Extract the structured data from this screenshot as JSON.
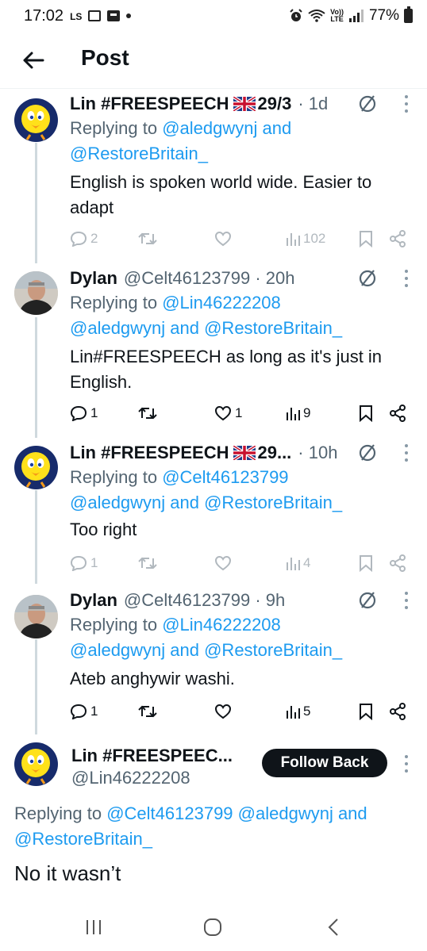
{
  "status_bar": {
    "time": "17:02",
    "ls": "LS",
    "volte_top": "Vo))",
    "volte_bottom": "LTE",
    "battery": "77%"
  },
  "header": {
    "title": "Post"
  },
  "tweets": [
    {
      "name": "Lin #FREESPEECH",
      "flag_suffix": "29/3",
      "handle": "",
      "time": "· 1d",
      "reply_label": "Replying to",
      "mentions": [
        "@aledgwynj and",
        "@RestoreBritain_"
      ],
      "text": "English is spoken world wide. Easier to adapt",
      "replies": "2",
      "retweets": "",
      "likes": "",
      "views": "102",
      "faded": true
    },
    {
      "name": "Dylan",
      "flag_suffix": "",
      "handle": "@Celt46123799 · 20h",
      "reply_label": "Replying to",
      "mentions": [
        "@Lin46222208",
        "@aledgwynj and @RestoreBritain_"
      ],
      "text": "Lin#FREESPEECH as long as it's just in English.",
      "replies": "1",
      "retweets": "",
      "likes": "1",
      "views": "9",
      "faded": false
    },
    {
      "name": "Lin #FREESPEECH",
      "flag_suffix": "29...",
      "handle": "",
      "time": "· 10h",
      "reply_label": "Replying to",
      "mentions": [
        "@Celt46123799",
        "@aledgwynj and @RestoreBritain_"
      ],
      "text": "Too right",
      "replies": "1",
      "retweets": "",
      "likes": "",
      "views": "4",
      "faded": true
    },
    {
      "name": "Dylan",
      "flag_suffix": "",
      "handle": "@Celt46123799 · 9h",
      "reply_label": "Replying to",
      "mentions": [
        "@Lin46222208",
        "@aledgwynj and @RestoreBritain_"
      ],
      "text": "Ateb anghywir washi.",
      "replies": "1",
      "retweets": "",
      "likes": "",
      "views": "5",
      "faded": false
    }
  ],
  "main_tweet": {
    "name": "Lin #FREESPEEC...",
    "handle": "@Lin46222208",
    "follow_label": "Follow Back",
    "reply_label": "Replying to",
    "mentions": "@Celt46123799 @aledgwynj and @RestoreBritain_",
    "text": "No it wasn’t"
  },
  "colors": {
    "link": "#1d9bf0",
    "secondary": "#536471",
    "thread_line": "#cfd9de",
    "button_bg": "#0f1419"
  }
}
